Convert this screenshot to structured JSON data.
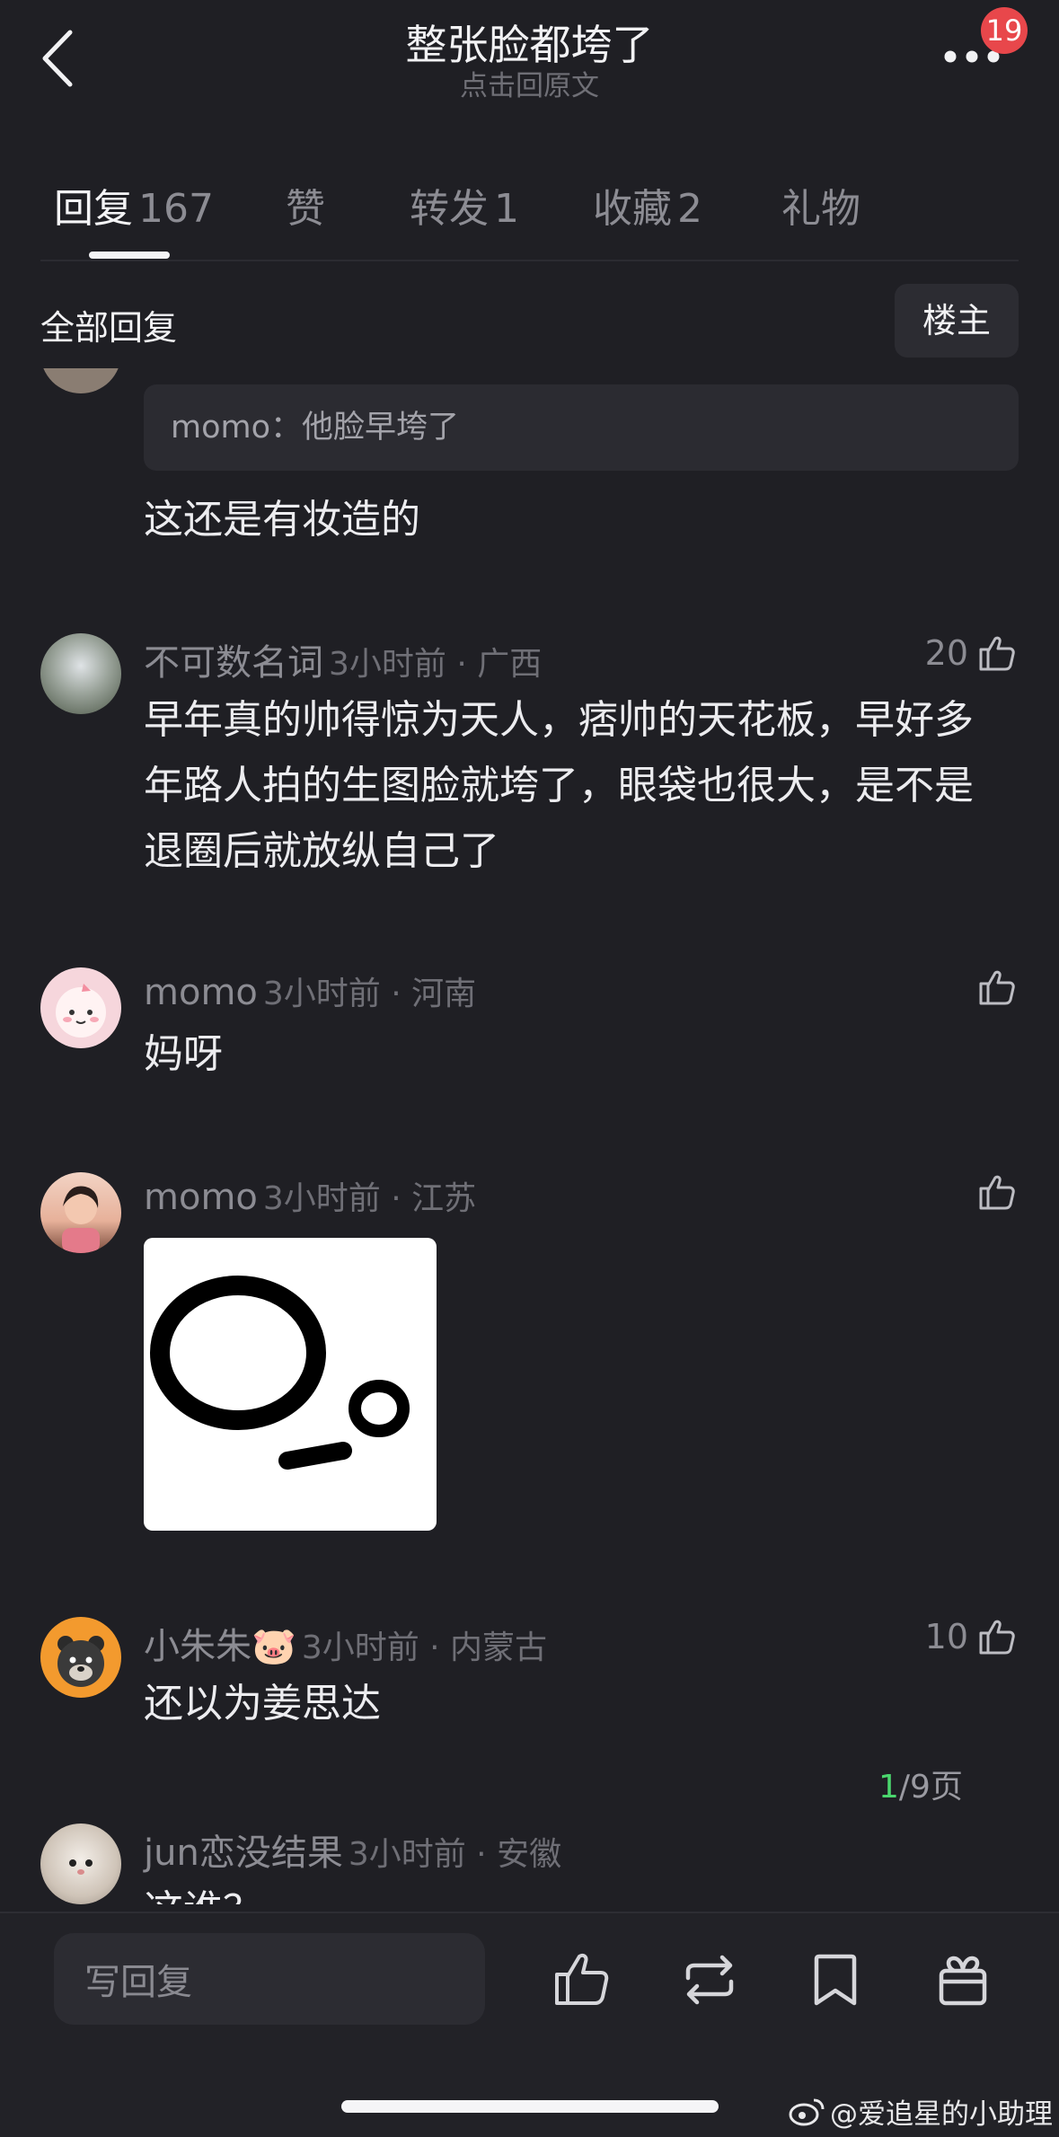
{
  "header": {
    "title": "整张脸都垮了",
    "subtitle": "点击回原文",
    "notification_count": "19"
  },
  "tabs": [
    {
      "label": "回复",
      "count": "167",
      "active": true
    },
    {
      "label": "赞",
      "count": ""
    },
    {
      "label": "转发",
      "count": "1"
    },
    {
      "label": "收藏",
      "count": "2"
    },
    {
      "label": "礼物",
      "count": ""
    }
  ],
  "section": {
    "title": "全部回复",
    "filter_button": "楼主"
  },
  "replies": [
    {
      "quote": "momo：他脸早垮了",
      "text": "这还是有妆造的"
    },
    {
      "username": "不可数名词",
      "time_location": "3小时前 · 广西",
      "likes": "20",
      "text": "早年真的帅得惊为天人，痞帅的天花板，早好多年路人拍的生图脸就垮了，眼袋也很大，是不是退圈后就放纵自己了"
    },
    {
      "username": "momo",
      "time_location": "3小时前 · 河南",
      "likes": "",
      "text": "妈呀"
    },
    {
      "username": "momo",
      "time_location": "3小时前 · 江苏",
      "likes": "",
      "image_icon": "surprised-face-sticker"
    },
    {
      "username": "小朱朱🐷",
      "time_location": "3小时前 · 内蒙古",
      "likes": "10",
      "text": "还以为姜思达"
    },
    {
      "username": "jun恋没结果",
      "time_location": "3小时前 · 安徽",
      "likes": "",
      "text": "这谁？"
    }
  ],
  "pagination": {
    "current": "1",
    "total_text": "/9页"
  },
  "bottom_bar": {
    "reply_placeholder": "写回复",
    "icons": [
      "like-icon",
      "repost-icon",
      "bookmark-icon",
      "gift-icon"
    ]
  },
  "watermark": "@爱追星的小助理",
  "colors": {
    "background": "#1f1f24",
    "badge": "#e8474b",
    "page_current": "#4ad66d"
  }
}
